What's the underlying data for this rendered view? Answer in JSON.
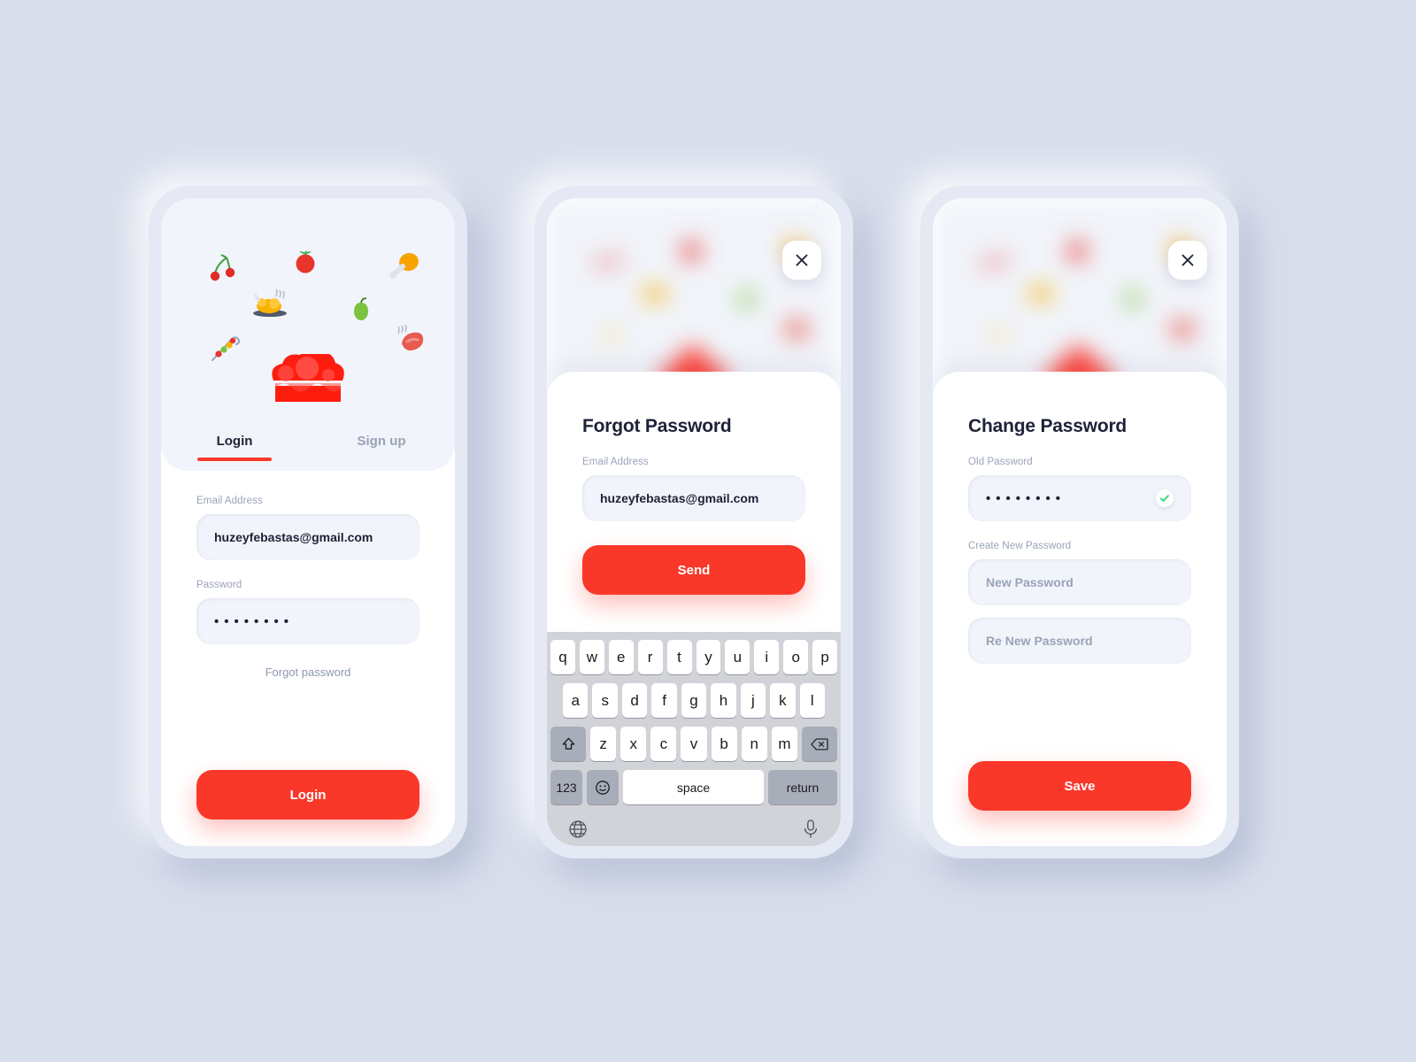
{
  "theme": {
    "page_background": "#D8DEEC",
    "accent_red": "#F9382A",
    "surface": "#F1F4FA",
    "text_dark": "#1D2236",
    "text_muted": "#9AA3B8",
    "success_green": "#2DDC7F"
  },
  "screens": {
    "login": {
      "name": "Login screen",
      "hero_icons": [
        "cherries-icon",
        "tomato-icon",
        "chicken-drumstick-icon",
        "roast-chicken-icon",
        "pear-icon",
        "kebab-skewer-icon",
        "steak-icon"
      ],
      "logo": "chef-hat-logo",
      "tabs": [
        {
          "label": "Login",
          "active": true
        },
        {
          "label": "Sign up",
          "active": false
        }
      ],
      "email": {
        "label": "Email Address",
        "value": "huzeyfebastas@gmail.com",
        "placeholder": "Email Address"
      },
      "password": {
        "label": "Password",
        "value": "••••••••",
        "placeholder": "Password"
      },
      "forgot_link": "Forgot password",
      "submit_label": "Login"
    },
    "forgot": {
      "name": "Forgot Password sheet",
      "close_icon": "close-icon",
      "title": "Forgot Password",
      "email": {
        "label": "Email Address",
        "value": "huzeyfebastas@gmail.com",
        "placeholder": "Email Address"
      },
      "submit_label": "Send"
    },
    "change": {
      "name": "Change Password sheet",
      "close_icon": "close-icon",
      "title": "Change Password",
      "old_password": {
        "label": "Old Password",
        "value": "••••••••",
        "valid_icon": "check-icon"
      },
      "create_new_label": "Create New Password",
      "new_password": {
        "placeholder": "New Password",
        "value": ""
      },
      "re_new_password": {
        "placeholder": "Re New Password",
        "value": ""
      },
      "submit_label": "Save"
    }
  },
  "keyboard": {
    "row1": [
      "q",
      "w",
      "e",
      "r",
      "t",
      "y",
      "u",
      "i",
      "o",
      "p"
    ],
    "row2": [
      "a",
      "s",
      "d",
      "f",
      "g",
      "h",
      "j",
      "k",
      "l"
    ],
    "row3": [
      "z",
      "x",
      "c",
      "v",
      "b",
      "n",
      "m"
    ],
    "shift_icon": "shift-icon",
    "backspace_icon": "backspace-icon",
    "numbers_key": "123",
    "emoji_icon": "emoji-icon",
    "space_key": "space",
    "return_key": "return",
    "globe_icon": "globe-icon",
    "microphone_icon": "microphone-icon"
  }
}
